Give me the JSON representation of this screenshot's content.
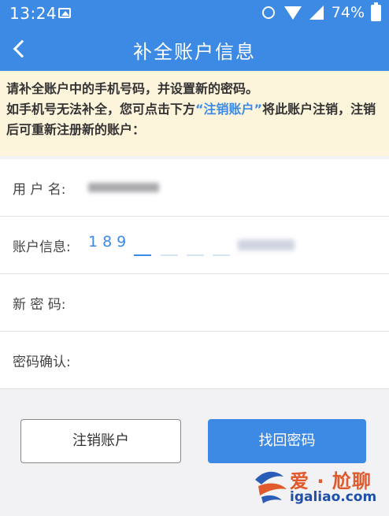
{
  "status_bar": {
    "time": "13:24",
    "battery": "74%",
    "icons": [
      "image-icon",
      "alarm-icon",
      "wifi-icon",
      "signal-icon",
      "battery-icon"
    ]
  },
  "nav": {
    "back_icon": "chevron-left-icon",
    "title": "补全账户信息"
  },
  "notice": {
    "line1": "请补全账户中的手机号码，并设置新的密码。",
    "line2_prefix": "如手机号无法补全，您可点击下方",
    "line2_link": "“注销账户”",
    "line2_suffix": "将此账户注销，注销后可重新注册新的账户："
  },
  "form": {
    "username_label": "用 户 名:",
    "account_label": "账户信息:",
    "account_value": "189",
    "new_password_label": "新 密 码:",
    "confirm_label": "密码确认:"
  },
  "buttons": {
    "cancel_account": "注销账户",
    "recover_password": "找回密码"
  },
  "watermark": {
    "name": "爱 · 尬聊",
    "url": "igaliao.com"
  },
  "colors": {
    "accent": "#3d8ae5",
    "notice_bg": "#fdf4dc",
    "page_bg": "#f2f2f4"
  }
}
